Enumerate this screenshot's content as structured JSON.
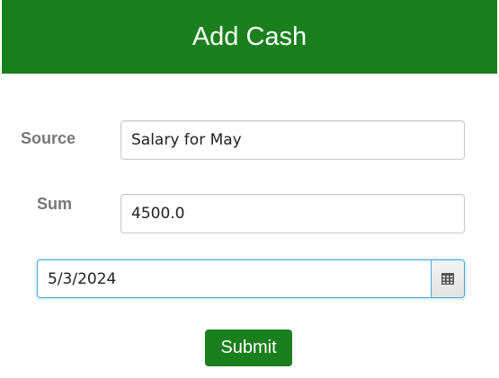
{
  "header": {
    "title": "Add Cash",
    "background_color": "#1a7f1d"
  },
  "form": {
    "source_label": "Source",
    "source_value": "Salary for May",
    "sum_label": "Sum",
    "sum_value": "4500.0",
    "date_value": "5/3/2024",
    "calendar_icon": "calendar-icon",
    "submit_label": "Submit",
    "focus_color": "#4aa8d8"
  }
}
